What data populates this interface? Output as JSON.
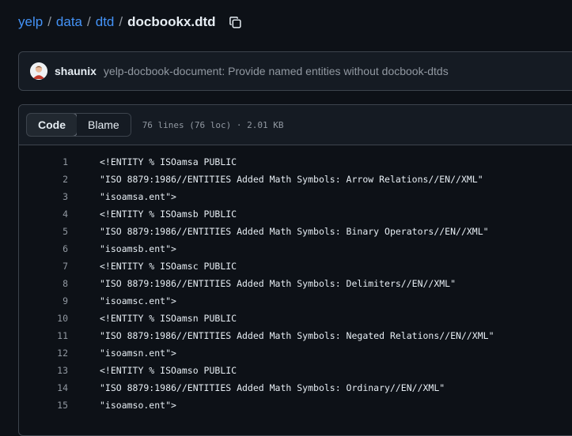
{
  "breadcrumb": {
    "repo": "yelp",
    "dir1": "data",
    "dir2": "dtd",
    "separator": "/",
    "file": "docbookx.dtd",
    "copy_icon": "copy-icon"
  },
  "commit": {
    "author": "shaunix",
    "message": "yelp-docbook-document: Provide named entities without docbook-dtds"
  },
  "file_header": {
    "tabs": [
      "Code",
      "Blame"
    ],
    "active_tab": "Code",
    "stats": "76 lines (76 loc) · 2.01 KB"
  },
  "code_lines": [
    {
      "num": "1",
      "text": "<!ENTITY % ISOamsa PUBLIC"
    },
    {
      "num": "2",
      "text": "\"ISO 8879:1986//ENTITIES Added Math Symbols: Arrow Relations//EN//XML\""
    },
    {
      "num": "3",
      "text": "\"isoamsa.ent\">"
    },
    {
      "num": "4",
      "text": "<!ENTITY % ISOamsb PUBLIC"
    },
    {
      "num": "5",
      "text": "\"ISO 8879:1986//ENTITIES Added Math Symbols: Binary Operators//EN//XML\""
    },
    {
      "num": "6",
      "text": "\"isoamsb.ent\">"
    },
    {
      "num": "7",
      "text": "<!ENTITY % ISOamsc PUBLIC"
    },
    {
      "num": "8",
      "text": "\"ISO 8879:1986//ENTITIES Added Math Symbols: Delimiters//EN//XML\""
    },
    {
      "num": "9",
      "text": "\"isoamsc.ent\">"
    },
    {
      "num": "10",
      "text": "<!ENTITY % ISOamsn PUBLIC"
    },
    {
      "num": "11",
      "text": "\"ISO 8879:1986//ENTITIES Added Math Symbols: Negated Relations//EN//XML\""
    },
    {
      "num": "12",
      "text": "\"isoamsn.ent\">"
    },
    {
      "num": "13",
      "text": "<!ENTITY % ISOamso PUBLIC"
    },
    {
      "num": "14",
      "text": "\"ISO 8879:1986//ENTITIES Added Math Symbols: Ordinary//EN//XML\""
    },
    {
      "num": "15",
      "text": "\"isoamso.ent\">"
    }
  ],
  "colors": {
    "background": "#0d1117",
    "link": "#4493f8",
    "muted": "#9198a1",
    "border": "#3d444d"
  }
}
